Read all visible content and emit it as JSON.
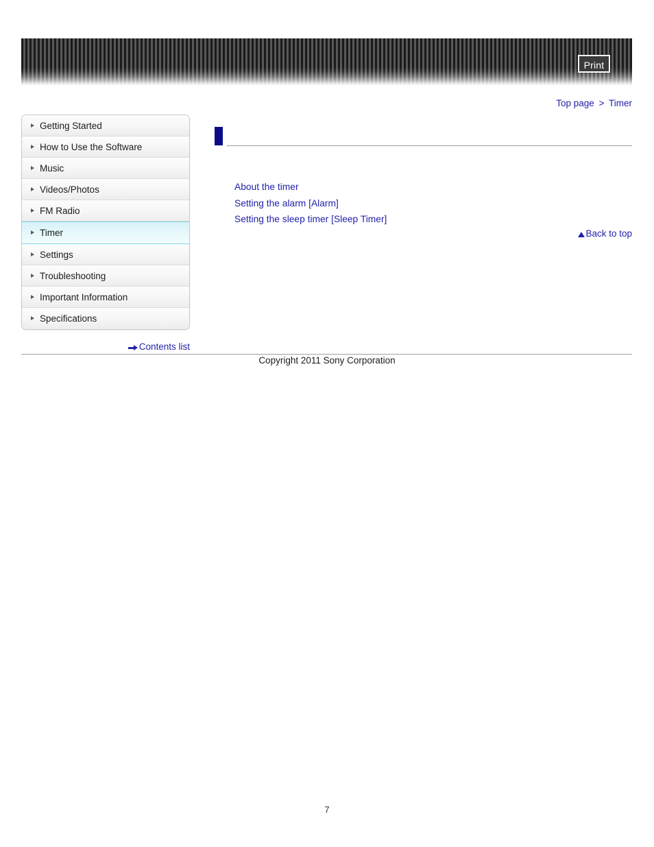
{
  "header": {
    "print_label": "Print",
    "stripe_dark": "#1a1a1a",
    "stripe_light": "#585858"
  },
  "breadcrumb": {
    "top_label": "Top page",
    "separator": ">",
    "current_label": "Timer"
  },
  "sidebar": {
    "items": [
      {
        "label": "Getting Started",
        "active": false
      },
      {
        "label": "How to Use the Software",
        "active": false
      },
      {
        "label": "Music",
        "active": false
      },
      {
        "label": "Videos/Photos",
        "active": false
      },
      {
        "label": "FM Radio",
        "active": false
      },
      {
        "label": "Timer",
        "active": true
      },
      {
        "label": "Settings",
        "active": false
      },
      {
        "label": "Troubleshooting",
        "active": false
      },
      {
        "label": "Important Information",
        "active": false
      },
      {
        "label": "Specifications",
        "active": false
      }
    ],
    "contents_list_label": "Contents list",
    "active_color": "#7fd4e6"
  },
  "main": {
    "title": "",
    "links": [
      "About the timer",
      "Setting the alarm [Alarm]",
      "Setting the sleep timer [Sleep Timer]"
    ],
    "back_to_top_label": "Back to top",
    "marker_color": "#0b0b87",
    "link_color": "#2222aa"
  },
  "footer": {
    "copyright": "Copyright 2011 Sony Corporation",
    "page_number": "7"
  }
}
